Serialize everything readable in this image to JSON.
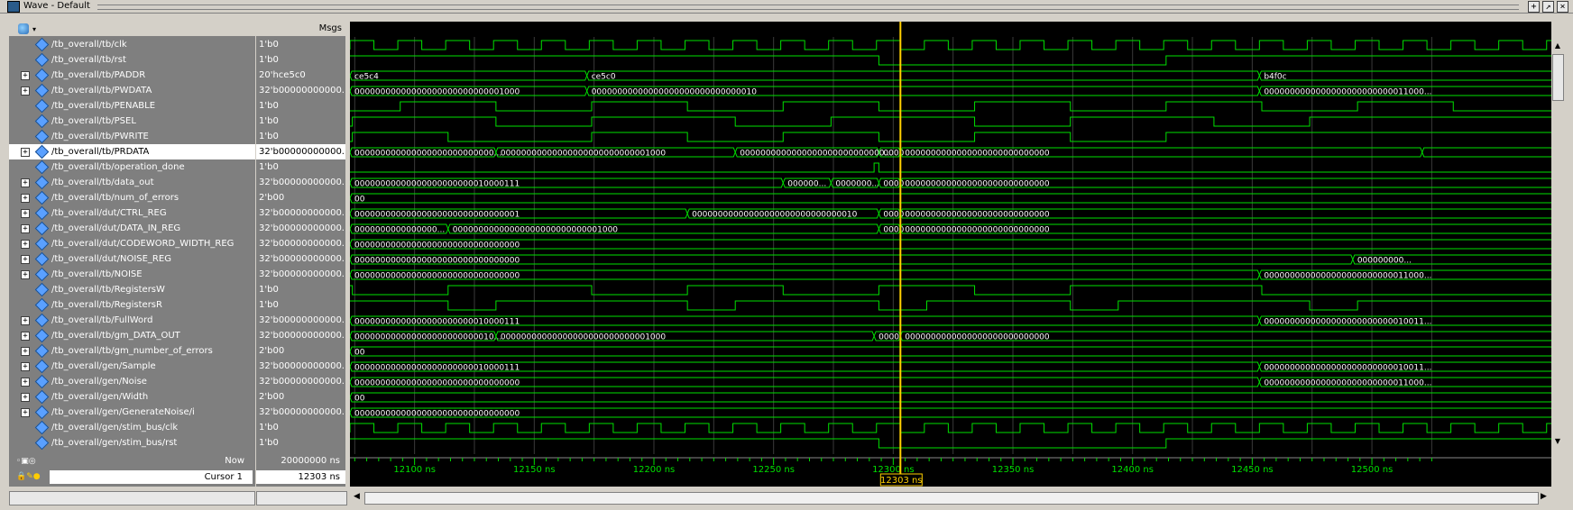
{
  "window": {
    "title": "Wave - Default"
  },
  "header": {
    "msgs_label": "Msgs"
  },
  "now": {
    "label": "Now",
    "value": "20000000 ns"
  },
  "cursor": {
    "label": "Cursor 1",
    "value": "12303 ns",
    "flag_label": "12303 ns"
  },
  "timeline": {
    "ticks": [
      {
        "t": 12100,
        "label": "12100 ns"
      },
      {
        "t": 12150,
        "label": "12150 ns"
      },
      {
        "t": 12200,
        "label": "12200 ns"
      },
      {
        "t": 12250,
        "label": "12250 ns"
      },
      {
        "t": 12300,
        "label": "12300 ns"
      },
      {
        "t": 12350,
        "label": "12350 ns"
      },
      {
        "t": 12400,
        "label": "12400 ns"
      },
      {
        "t": 12450,
        "label": "12450 ns"
      },
      {
        "t": 12500,
        "label": "12500 ns"
      }
    ],
    "cursor_time": 12303
  },
  "colors": {
    "wave": "#00e000",
    "cursor": "#ffd000",
    "background": "#000000",
    "pane": "#7f7f7f"
  },
  "signals": [
    {
      "name": "/tb_overall/tb/clk",
      "value": "1'b0",
      "bus": false
    },
    {
      "name": "/tb_overall/tb/rst",
      "value": "1'b0",
      "bus": false
    },
    {
      "name": "/tb_overall/tb/PADDR",
      "value": "20'hce5c0",
      "bus": true,
      "segs": [
        "ce5c4",
        "ce5c0",
        "b4f0c"
      ]
    },
    {
      "name": "/tb_overall/tb/PWDATA",
      "value": "32'b00000000000...",
      "bus": true,
      "segs": [
        "00000000000000000000000000001000",
        "00000000000000000000000000000010",
        "0000000000000000000000000011000..."
      ]
    },
    {
      "name": "/tb_overall/tb/PENABLE",
      "value": "1'b0",
      "bus": false
    },
    {
      "name": "/tb_overall/tb/PSEL",
      "value": "1'b0",
      "bus": false
    },
    {
      "name": "/tb_overall/tb/PWRITE",
      "value": "1'b0",
      "bus": false
    },
    {
      "name": "/tb_overall/tb/PRDATA",
      "value": "32'b00000000000...",
      "bus": true,
      "selected": true,
      "segs": [
        "000000000000000000000000000...",
        "00000000000000000000000000001000",
        "0000000000000000000000000000...",
        "0000",
        "0000000000000000000000000000"
      ]
    },
    {
      "name": "/tb_overall/tb/operation_done",
      "value": "1'b0",
      "bus": false
    },
    {
      "name": "/tb_overall/tb/data_out",
      "value": "32'b00000000000...",
      "bus": true,
      "segs": [
        "00000000000000000000000010000111",
        "000000...",
        "0000000...",
        "0000",
        "0000000000000000000000000000"
      ]
    },
    {
      "name": "/tb_overall/tb/num_of_errors",
      "value": "2'b00",
      "bus": true,
      "segs": [
        "00"
      ]
    },
    {
      "name": "/tb_overall/dut/CTRL_REG",
      "value": "32'b00000000000...",
      "bus": true,
      "segs": [
        "00000000000000000000000000000001",
        "00000000000000000000000000000010",
        "0000",
        "0000000000000000000000000000"
      ]
    },
    {
      "name": "/tb_overall/dut/DATA_IN_REG",
      "value": "32'b00000000000...",
      "bus": true,
      "segs": [
        "0000000000000000...",
        "00000000000000000000000000001000",
        "0000",
        "0000000000000000000000000000"
      ]
    },
    {
      "name": "/tb_overall/dut/CODEWORD_WIDTH_REG",
      "value": "32'b00000000000...",
      "bus": true,
      "segs": [
        "00000000000000000000000000000000"
      ]
    },
    {
      "name": "/tb_overall/dut/NOISE_REG",
      "value": "32'b00000000000...",
      "bus": true,
      "segs": [
        "00000000000000000000000000000000",
        "000000000..."
      ]
    },
    {
      "name": "/tb_overall/tb/NOISE",
      "value": "32'b00000000000...",
      "bus": true,
      "segs": [
        "00000000000000000000000000000000",
        "0000000000000000000000000011000..."
      ]
    },
    {
      "name": "/tb_overall/tb/RegistersW",
      "value": "1'b0",
      "bus": false
    },
    {
      "name": "/tb_overall/tb/RegistersR",
      "value": "1'b0",
      "bus": false
    },
    {
      "name": "/tb_overall/tb/FullWord",
      "value": "32'b00000000000...",
      "bus": true,
      "segs": [
        "00000000000000000000000010000111",
        "0000000000000000000000000010011..."
      ]
    },
    {
      "name": "/tb_overall/tb/gm_DATA_OUT",
      "value": "32'b00000000000...",
      "bus": true,
      "segs": [
        "000000000000000000000000010...",
        "00000000000000000000000000001000",
        "0000",
        "0000000000000000000000000000"
      ]
    },
    {
      "name": "/tb_overall/tb/gm_number_of_errors",
      "value": "2'b00",
      "bus": true,
      "segs": [
        "00"
      ]
    },
    {
      "name": "/tb_overall/gen/Sample",
      "value": "32'b00000000000...",
      "bus": true,
      "segs": [
        "00000000000000000000000010000111",
        "0000000000000000000000000010011..."
      ]
    },
    {
      "name": "/tb_overall/gen/Noise",
      "value": "32'b00000000000...",
      "bus": true,
      "segs": [
        "00000000000000000000000000000000",
        "0000000000000000000000000011000..."
      ]
    },
    {
      "name": "/tb_overall/gen/Width",
      "value": "2'b00",
      "bus": true,
      "segs": [
        "00"
      ]
    },
    {
      "name": "/tb_overall/gen/GenerateNoise/i",
      "value": "32'b00000000000...",
      "bus": true,
      "segs": [
        "00000000000000000000000000000000"
      ]
    },
    {
      "name": "/tb_overall/gen/stim_bus/clk",
      "value": "1'b0",
      "bus": false
    },
    {
      "name": "/tb_overall/gen/stim_bus/rst",
      "value": "1'b0",
      "bus": false
    }
  ]
}
